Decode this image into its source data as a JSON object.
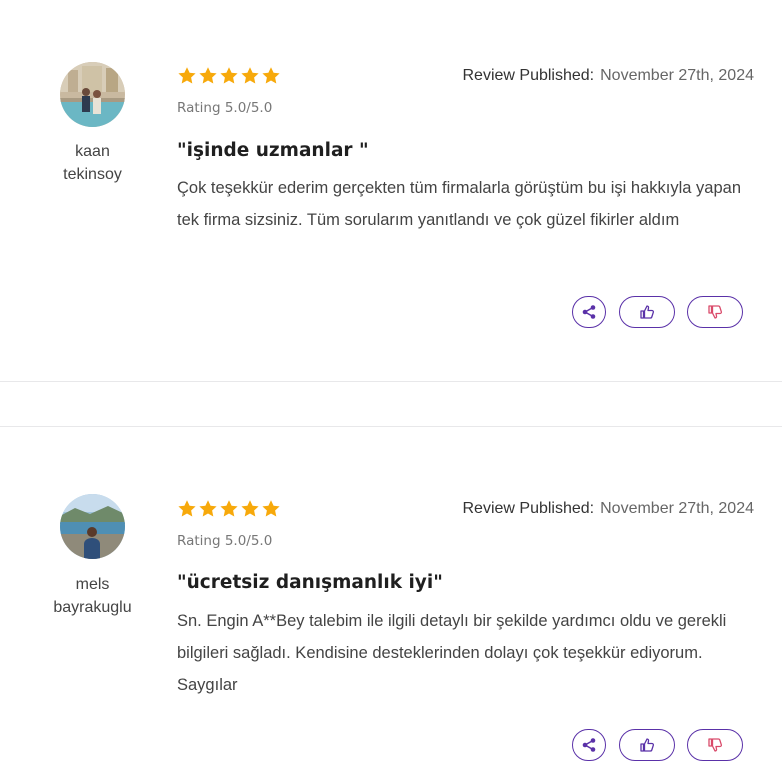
{
  "colors": {
    "star": "#f7a90b",
    "accent": "#5a31a8",
    "dislike": "#d94a6a"
  },
  "reviews": [
    {
      "user": {
        "first": "kaan",
        "last": "tekinsoy"
      },
      "stars": 5,
      "rating_text": "Rating 5.0/5.0",
      "published_label": "Review Published:",
      "published_date": "November 27th, 2024",
      "title": "\"işinde uzmanlar \"",
      "body": "Çok teşekkür ederim gerçekten tüm firmalarla görüştüm bu işi hakkıyla yapan tek firma sizsiniz. Tüm sorularım yanıtlandı ve çok güzel fikirler aldım"
    },
    {
      "user": {
        "first": "mels",
        "last": "bayrakuglu"
      },
      "stars": 5,
      "rating_text": "Rating 5.0/5.0",
      "published_label": "Review Published:",
      "published_date": "November 27th, 2024",
      "title": "\"ücretsiz danışmanlık iyi\"",
      "body": "Sn. Engin A**Bey talebim ile ilgili detaylı bir şekilde yardımcı oldu ve gerekli bilgileri sağladı. Kendisine desteklerinden dolayı çok teşekkür ediyorum. Saygılar"
    }
  ]
}
